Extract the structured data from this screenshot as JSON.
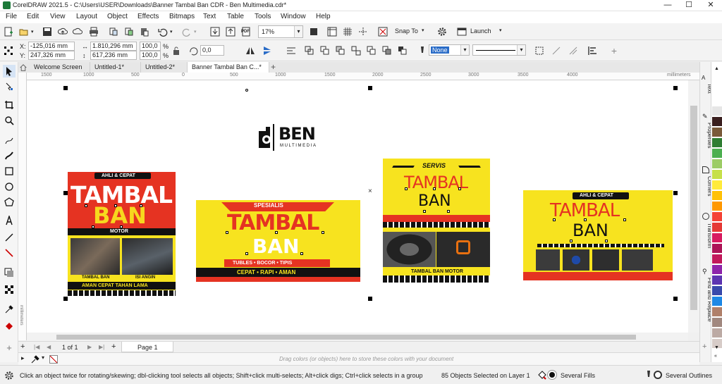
{
  "app": {
    "title": "CorelDRAW 2021.5 - C:\\Users\\USER\\Downloads\\Banner Tambal Ban CDR - Ben Multimedia.cdr*",
    "window_controls": [
      "—",
      "☐",
      "✕"
    ]
  },
  "menu": [
    "File",
    "Edit",
    "View",
    "Layout",
    "Object",
    "Effects",
    "Bitmaps",
    "Text",
    "Table",
    "Tools",
    "Window",
    "Help"
  ],
  "toolbar1": {
    "zoom": "17%",
    "snap_to": "Snap To",
    "launch": "Launch",
    "pdf_label": "PDF"
  },
  "toolbar2": {
    "x_label": "X:",
    "x_value": "-125,016 mm",
    "y_label": "Y:",
    "y_value": "247,326 mm",
    "w_value": "1.810,296 mm",
    "h_value": "617,236 mm",
    "scale_w": "100,0",
    "scale_h": "100,0",
    "percent": "%",
    "rotation": "0,0",
    "outline_width": "None"
  },
  "tabs": [
    "Welcome Screen",
    "Untitled-1*",
    "Untitled-2*",
    "Banner Tambal Ban C...*"
  ],
  "tab_add": "+",
  "ruler": {
    "ticks": [
      "1500",
      "1000",
      "500",
      "0",
      "500",
      "1000",
      "1500",
      "2000",
      "2500",
      "3000",
      "3500",
      "4000"
    ],
    "unit": "millimeters",
    "vertical_unit": "millimeters"
  },
  "canvas": {
    "logo_main": "BEN",
    "logo_sub": "MULTIMEDIA",
    "banners": [
      {
        "badge": "AHLI & CEPAT",
        "line1": "TAMBAL",
        "line2": "BAN",
        "strip": "MOTOR",
        "cap_left": "TAMBAL BAN",
        "cap_right": "ISI ANGIN",
        "footer": "AMAN CEPAT TAHAN LAMA"
      },
      {
        "badge": "SPESIALIS",
        "line1": "TAMBAL",
        "line2": "BAN",
        "strip": "TUBLES  •  BOCOR  •  TIPIS",
        "footer": "CEPAT  •  RAPI  •  AMAN"
      },
      {
        "badge": "SERVIS",
        "line1": "TAMBAL",
        "line2": "BAN",
        "footer": "TAMBAL BAN MOTOR"
      },
      {
        "badge": "AHLI & CEPAT",
        "line1": "TAMBAL",
        "line2": "BAN"
      }
    ]
  },
  "pagebar": {
    "page_of": "1  of  1",
    "page_tab": "Page 1"
  },
  "colorbar": {
    "hint": "Drag colors (or objects) here to store these colors with your document"
  },
  "status": {
    "hint": "Click an object twice for rotating/skewing; dbl-clicking tool selects all objects; Shift+click multi-selects; Alt+click digs; Ctrl+click selects in a group",
    "selection": "85 Objects Selected on Layer 1",
    "fill": "Several Fills",
    "outline": "Several Outlines"
  },
  "dockers": [
    "Text",
    "Properties",
    "Corners",
    "Transform",
    "Find and Replace"
  ],
  "palette": [
    "#ffffff",
    "#e6e6e6",
    "#3a1f1f",
    "#7a5a3a",
    "#2e7d32",
    "#4caf50",
    "#9ccc65",
    "#c6e04a",
    "#ffeb3b",
    "#ffc107",
    "#ff9800",
    "#f44336",
    "#e53935",
    "#d81b60",
    "#ad1457",
    "#c2185b",
    "#8e24aa",
    "#5e35b1",
    "#3949ab",
    "#1e88e5",
    "#b0806a",
    "#a1887f",
    "#bcaaa4",
    "#d7ccc8"
  ]
}
